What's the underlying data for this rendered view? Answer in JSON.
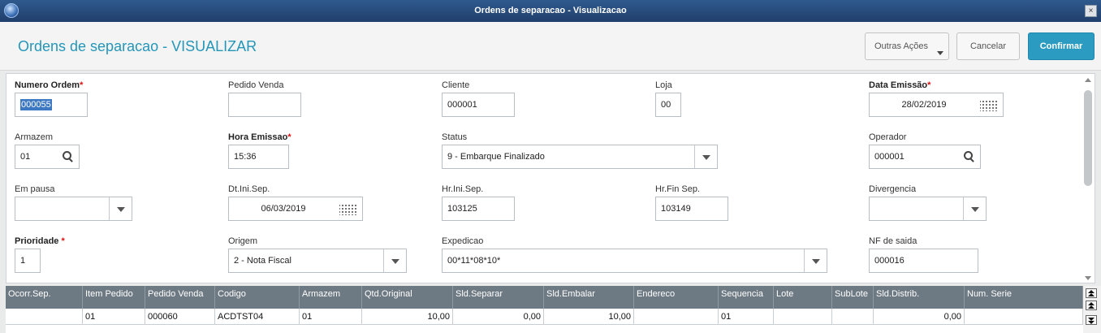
{
  "window": {
    "title": "Ordens de separacao - Visualizacao",
    "close_label": "×"
  },
  "header": {
    "title": "Ordens de separacao - VISUALIZAR",
    "buttons": {
      "outras": "Outras Ações",
      "cancelar": "Cancelar",
      "confirmar": "Confirmar"
    }
  },
  "form": {
    "numero_ordem": {
      "label": "Numero Ordem",
      "value": "000055"
    },
    "pedido_venda": {
      "label": "Pedido Venda",
      "value": ""
    },
    "cliente": {
      "label": "Cliente",
      "value": "000001"
    },
    "loja": {
      "label": "Loja",
      "value": "00"
    },
    "data_emissao": {
      "label": "Data Emissão",
      "value": "28/02/2019"
    },
    "armazem": {
      "label": "Armazem",
      "value": "01"
    },
    "hora_emissao": {
      "label": "Hora Emissao",
      "value": "15:36"
    },
    "status": {
      "label": "Status",
      "value": "9 - Embarque Finalizado"
    },
    "operador": {
      "label": "Operador",
      "value": "000001"
    },
    "em_pausa": {
      "label": "Em pausa",
      "value": ""
    },
    "dt_ini_sep": {
      "label": "Dt.Ini.Sep.",
      "value": "06/03/2019"
    },
    "hr_ini_sep": {
      "label": "Hr.Ini.Sep.",
      "value": "103125"
    },
    "hr_fin_sep": {
      "label": "Hr.Fin Sep.",
      "value": "103149"
    },
    "divergencia": {
      "label": "Divergencia",
      "value": ""
    },
    "prioridade": {
      "label": "Prioridade",
      "value": "1"
    },
    "origem": {
      "label": "Origem",
      "value": "2 - Nota Fiscal"
    },
    "expedicao": {
      "label": "Expedicao",
      "value": "00*11*08*10*"
    },
    "nf_saida": {
      "label": "NF de saida",
      "value": "000016"
    },
    "required_mark": "*"
  },
  "grid": {
    "columns": [
      "Ocorr.Sep.",
      "Item Pedido",
      "Pedido Venda",
      "Codigo",
      "Armazem",
      "Qtd.Original",
      "Sld.Separar",
      "Sld.Embalar",
      "Endereco",
      "Sequencia",
      "Lote",
      "SubLote",
      "Sld.Distrib.",
      "Num. Serie"
    ],
    "rows": [
      [
        "",
        "01",
        "000060",
        "ACDTST04",
        "01",
        "10,00",
        "0,00",
        "10,00",
        "",
        "01",
        "",
        "",
        "0,00",
        ""
      ]
    ]
  }
}
